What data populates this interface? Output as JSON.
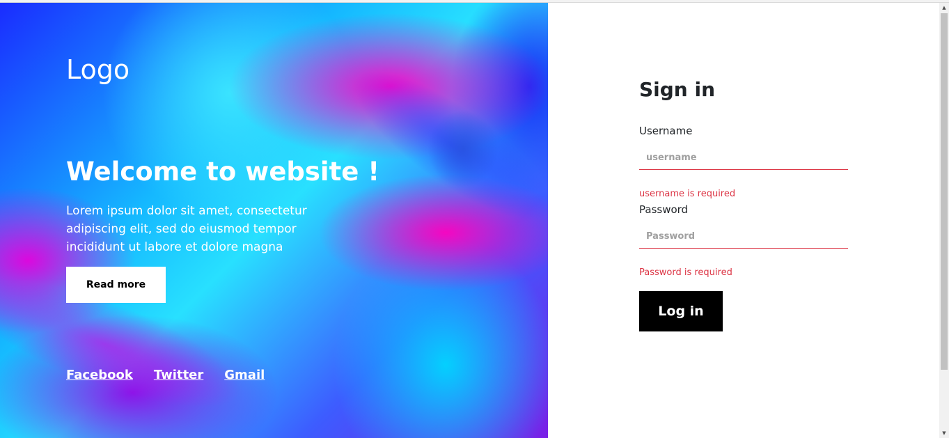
{
  "hero": {
    "logo": "Logo",
    "title": "Welcome to website !",
    "description": "Lorem ipsum dolor sit amet, consectetur adipiscing elit, sed do eiusmod tempor incididunt ut labore et dolore magna",
    "read_more_label": "Read more",
    "social_links": [
      "Facebook",
      "Twitter",
      "Gmail"
    ]
  },
  "signin": {
    "title": "Sign in",
    "username": {
      "label": "Username",
      "placeholder": "username",
      "value": "",
      "error": "username is required"
    },
    "password": {
      "label": "Password",
      "placeholder": "Password",
      "value": "",
      "error": "Password is required"
    },
    "login_label": "Log in"
  },
  "scrollbar": {
    "up_icon": "chevron-up-icon",
    "down_icon": "chevron-down-icon"
  },
  "colors": {
    "error": "#dc3545",
    "button_dark": "#000000",
    "text_dark": "#212529"
  }
}
